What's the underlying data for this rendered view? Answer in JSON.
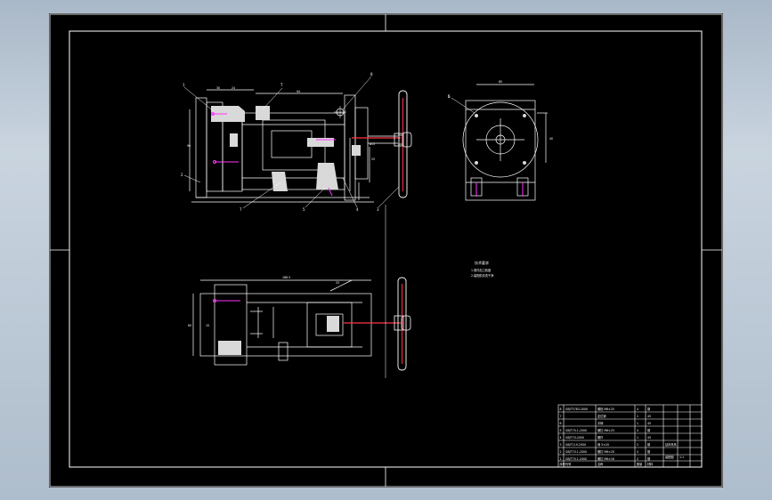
{
  "colors": {
    "sheet": "#000000",
    "line": "#ffffff",
    "accent": "#ff33ff",
    "hatch": "#d9d9d9",
    "chrome": "#b6c4d3"
  },
  "drawing": {
    "leaders": [
      "1",
      "T",
      "8",
      "6",
      "2",
      "7",
      "5",
      "3",
      "4",
      "5"
    ],
    "dims": {
      "d30": "30",
      "d24": "24",
      "d94": "94",
      "d90": "90",
      "d10": "10",
      "d60": "60",
      "d80": "80",
      "d40": "40",
      "d25": "25",
      "d188": "188.5",
      "d33": "33",
      "d15": "ø15"
    },
    "notes": [
      "技术要求",
      "1.零件加工精度",
      "2.装配前清洗干净"
    ]
  },
  "title_block": {
    "rows": [
      [
        "8",
        "GB/T5783-2000",
        "螺栓 M6×25",
        "4",
        "钢"
      ],
      [
        "7",
        "",
        "定位销",
        "1",
        "45"
      ],
      [
        "6",
        "",
        "手柄",
        "1",
        "45"
      ],
      [
        "5",
        "GB/T70.1-2000",
        "螺钉 M8×25",
        "4",
        "钢"
      ],
      [
        "4",
        "GB/T70-2000",
        "螺杆",
        "1",
        "45"
      ],
      [
        "3",
        "GB/T119-2000",
        "销 5×20",
        "2",
        "钢"
      ],
      [
        "2",
        "GB/T70.1-2000",
        "螺钉 M6×20",
        "4",
        "钢"
      ],
      [
        "1",
        "GB/T70.1-2000",
        "螺钉 M6×16",
        "2",
        "钢"
      ]
    ],
    "footer": [
      "序号",
      "代号",
      "名称",
      "数量",
      "材料"
    ],
    "title": "钻床夹具",
    "sheet_label": "装配图",
    "scale": "1:1"
  }
}
